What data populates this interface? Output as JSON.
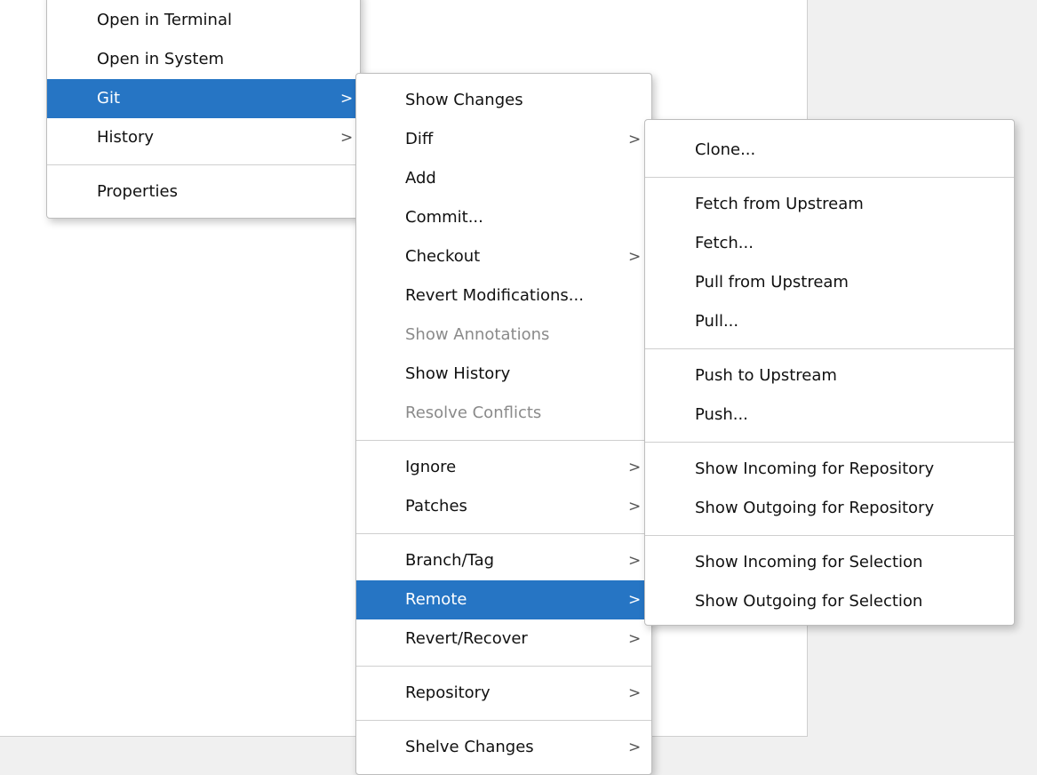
{
  "menu1": {
    "items": [
      {
        "label": "Open in Terminal"
      },
      {
        "label": "Open in System"
      },
      {
        "label": "Git",
        "arrow": ">"
      },
      {
        "label": "History",
        "arrow": ">"
      },
      {
        "label": "Properties"
      }
    ]
  },
  "menu2": {
    "items": [
      {
        "label": "Show Changes"
      },
      {
        "label": "Diff",
        "arrow": ">"
      },
      {
        "label": "Add"
      },
      {
        "label": "Commit..."
      },
      {
        "label": "Checkout",
        "arrow": ">"
      },
      {
        "label": "Revert Modifications..."
      },
      {
        "label": "Show Annotations"
      },
      {
        "label": "Show History"
      },
      {
        "label": "Resolve Conflicts"
      },
      {
        "label": "Ignore",
        "arrow": ">"
      },
      {
        "label": "Patches",
        "arrow": ">"
      },
      {
        "label": "Branch/Tag",
        "arrow": ">"
      },
      {
        "label": "Remote",
        "arrow": ">"
      },
      {
        "label": "Revert/Recover",
        "arrow": ">"
      },
      {
        "label": "Repository",
        "arrow": ">"
      },
      {
        "label": "Shelve Changes",
        "arrow": ">"
      }
    ]
  },
  "menu3": {
    "items": [
      {
        "label": "Clone..."
      },
      {
        "label": "Fetch from Upstream"
      },
      {
        "label": "Fetch..."
      },
      {
        "label": "Pull from Upstream"
      },
      {
        "label": "Pull..."
      },
      {
        "label": "Push to Upstream"
      },
      {
        "label": "Push..."
      },
      {
        "label": "Show Incoming for Repository"
      },
      {
        "label": "Show Outgoing for Repository"
      },
      {
        "label": "Show Incoming for Selection"
      },
      {
        "label": "Show Outgoing for Selection"
      }
    ]
  },
  "colors": {
    "selection": "#2675c4",
    "disabled_text": "#8a8a8a"
  }
}
